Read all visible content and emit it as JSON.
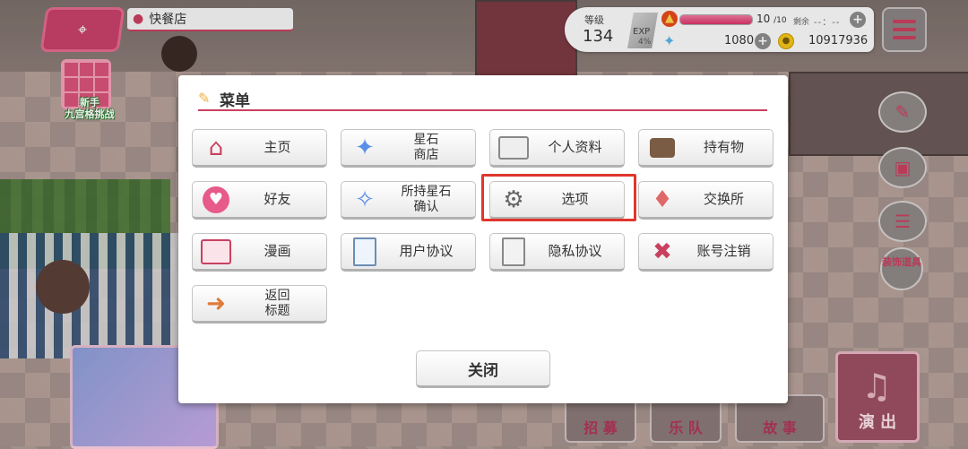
{
  "location": {
    "name": "快餐店"
  },
  "beginner": {
    "line1": "新手",
    "line2": "九宫格挑战"
  },
  "status": {
    "level_label": "等级",
    "level_value": "134",
    "exp_label": "EXP",
    "exp_percent": "4%",
    "stamina_current": "10",
    "stamina_max": "/10",
    "stamina_fraction": 1.0,
    "remain_label": "剩余",
    "remain_time": "--：--",
    "star_stones": "1080",
    "coins": "10917936"
  },
  "side_buttons": {
    "deco_label": "装饰道具"
  },
  "menu": {
    "title": "菜单",
    "items": [
      {
        "label": "主页",
        "icon": "house-icon"
      },
      {
        "label": "星石商店",
        "line1": "星石",
        "line2": "商店",
        "icon": "star-stone-icon"
      },
      {
        "label": "个人资料",
        "icon": "profile-card-icon"
      },
      {
        "label": "持有物",
        "icon": "bag-icon"
      },
      {
        "label": "好友",
        "icon": "friends-heart-icon"
      },
      {
        "label": "所持星石确认",
        "line1": "所持星石",
        "line2": "确认",
        "icon": "star-search-icon"
      },
      {
        "label": "选项",
        "icon": "gear-icon"
      },
      {
        "label": "交换所",
        "icon": "exchange-icon"
      },
      {
        "label": "漫画",
        "icon": "comic-icon"
      },
      {
        "label": "用户协议",
        "icon": "document-icon"
      },
      {
        "label": "隐私协议",
        "icon": "lock-document-icon"
      },
      {
        "label": "账号注销",
        "icon": "tools-icon"
      },
      {
        "label": "返回标题",
        "line1": "返回",
        "line2": "标题",
        "icon": "return-icon"
      }
    ],
    "close_label": "关闭"
  },
  "bottom_nav": {
    "recruit": "招 募",
    "band": "乐 队",
    "story": "故 事",
    "live": "演 出"
  },
  "colors": {
    "accent": "#c9415f",
    "highlight": "#e0362c"
  }
}
